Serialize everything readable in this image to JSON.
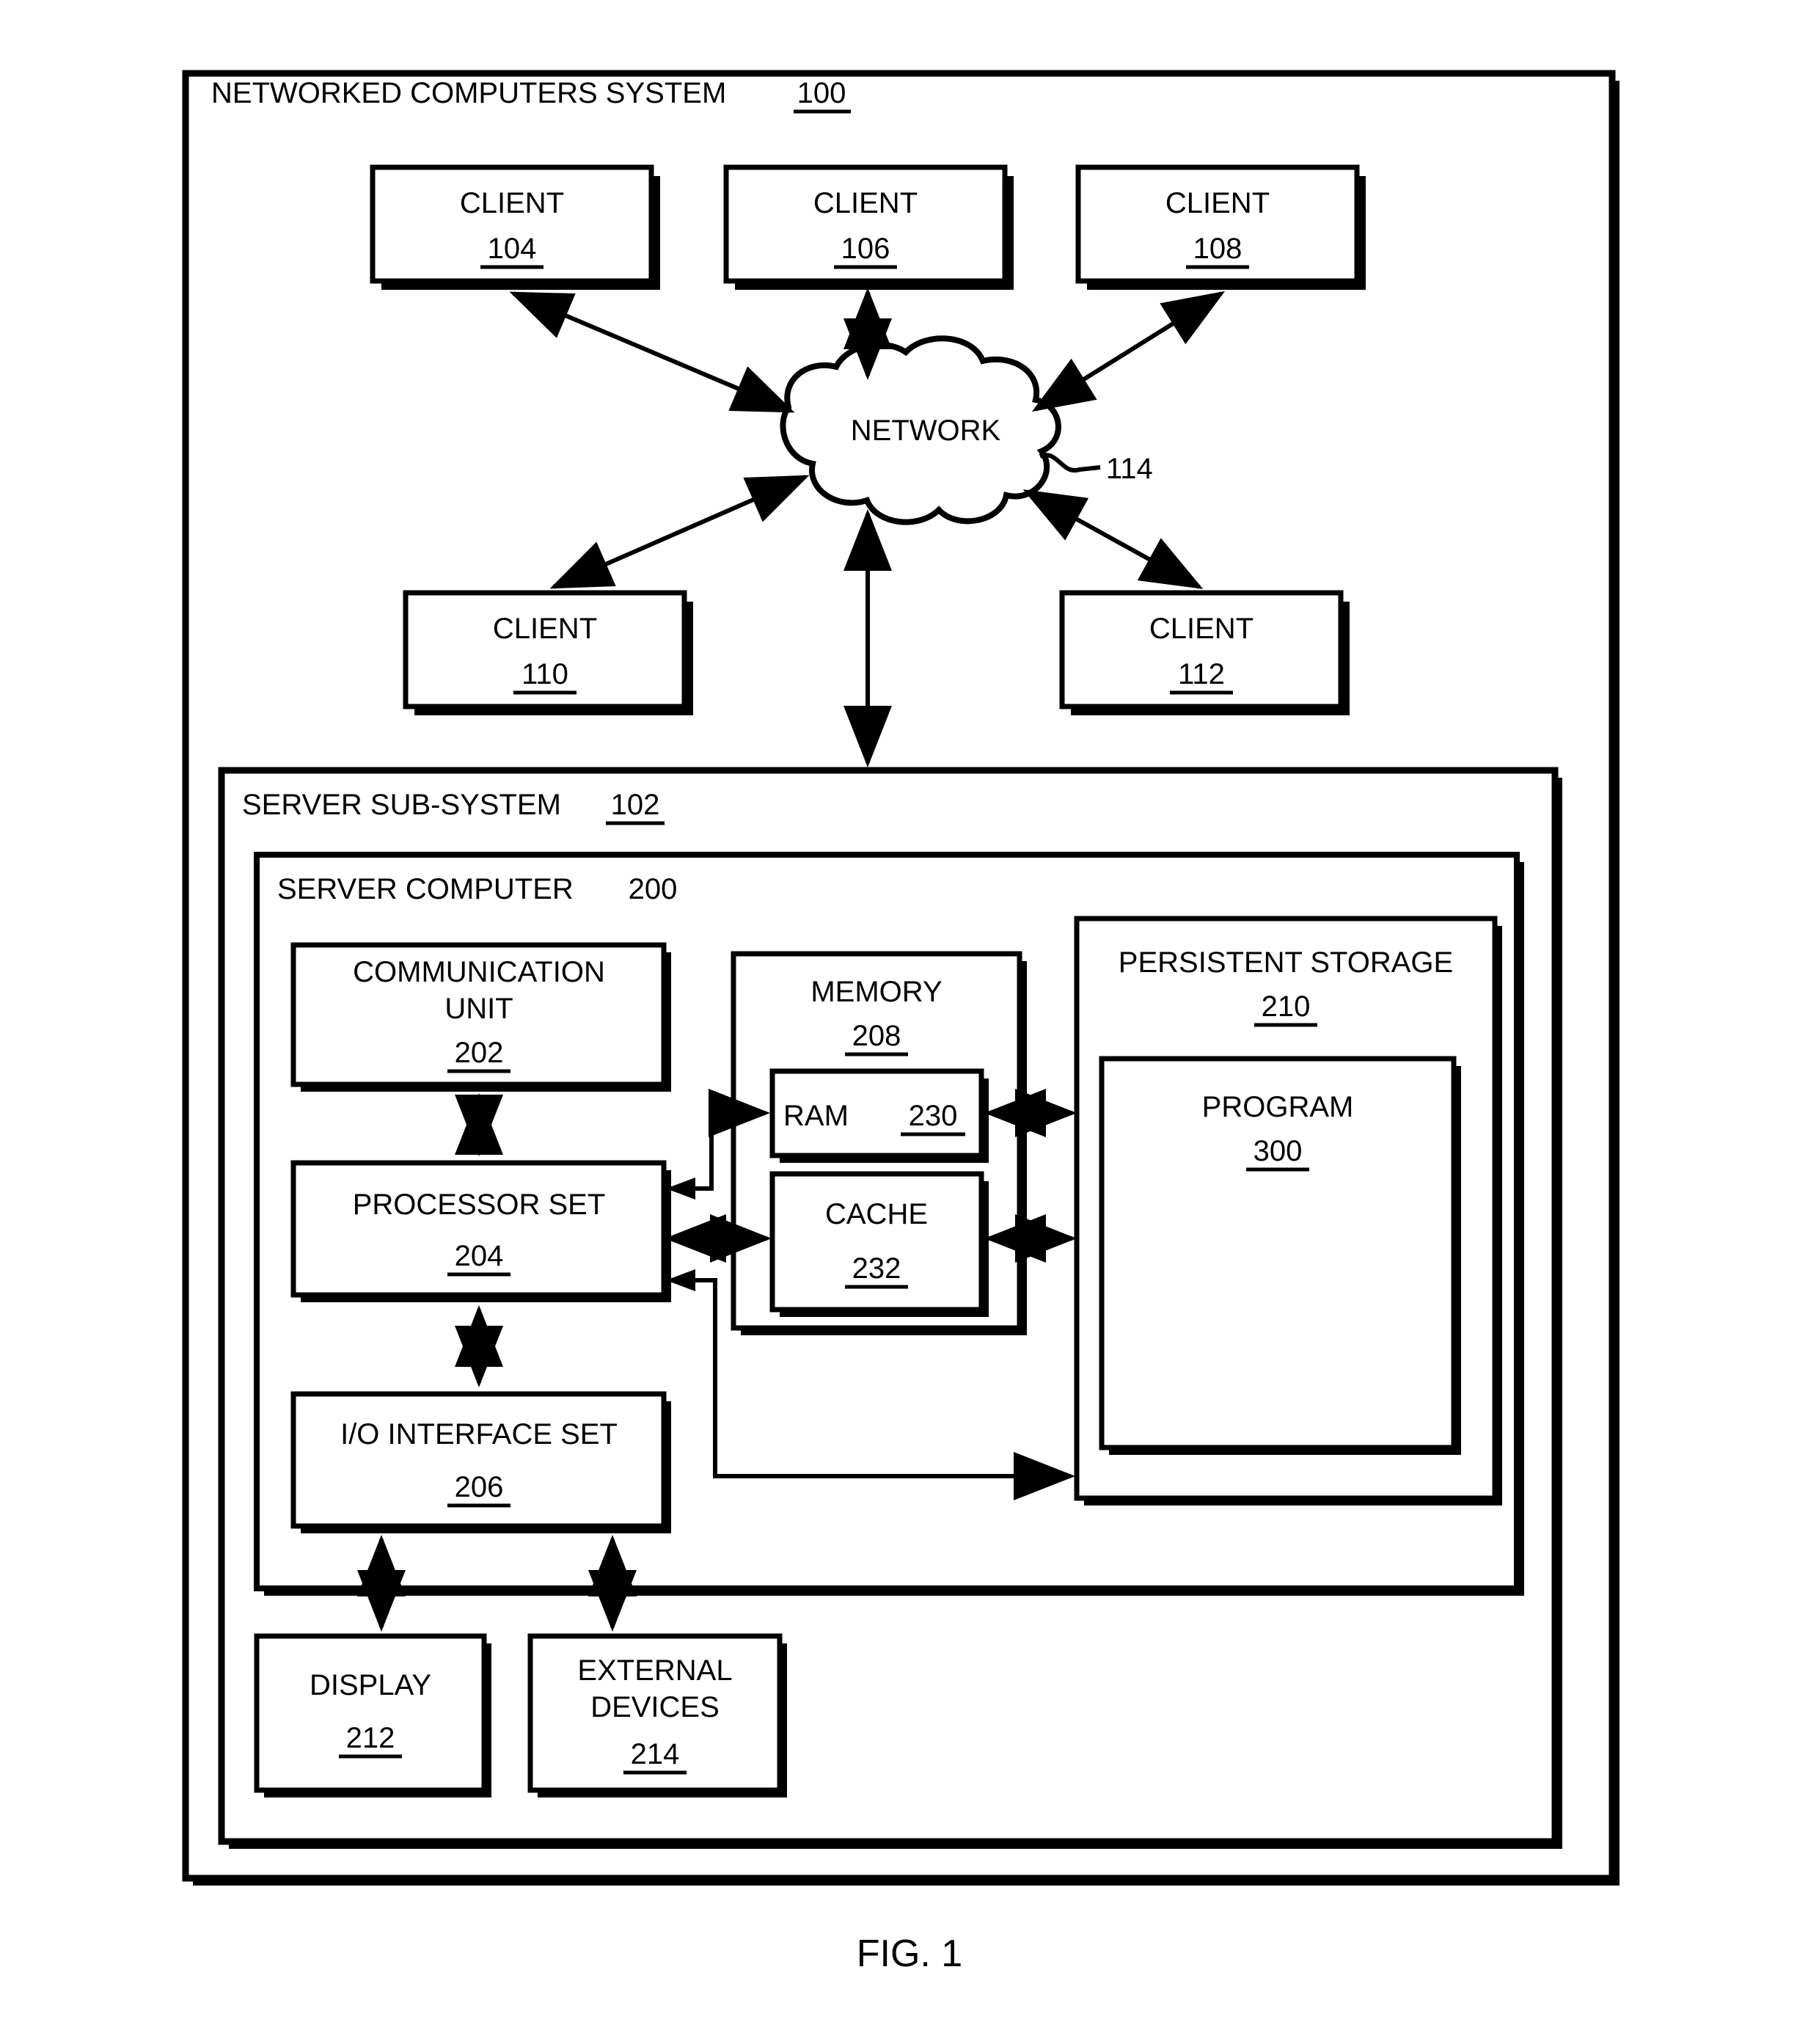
{
  "figure": {
    "caption": "FIG. 1",
    "outer_title": "NETWORKED COMPUTERS SYSTEM",
    "outer_ref": "100"
  },
  "clients": [
    {
      "label": "CLIENT",
      "ref": "104"
    },
    {
      "label": "CLIENT",
      "ref": "106"
    },
    {
      "label": "CLIENT",
      "ref": "108"
    },
    {
      "label": "CLIENT",
      "ref": "110"
    },
    {
      "label": "CLIENT",
      "ref": "112"
    }
  ],
  "network": {
    "label": "NETWORK",
    "ref": "114"
  },
  "server_subsystem": {
    "title": "SERVER SUB-SYSTEM",
    "ref": "102"
  },
  "server_computer": {
    "title": "SERVER COMPUTER",
    "ref": "200"
  },
  "components": {
    "communication_unit": {
      "line1": "COMMUNICATION",
      "line2": "UNIT",
      "ref": "202"
    },
    "processor_set": {
      "line1": "PROCESSOR SET",
      "ref": "204"
    },
    "io_interface_set": {
      "line1": "I/O INTERFACE SET",
      "ref": "206"
    },
    "memory": {
      "line1": "MEMORY",
      "ref": "208"
    },
    "ram": {
      "line1": "RAM",
      "ref": "230"
    },
    "cache": {
      "line1": "CACHE",
      "ref": "232"
    },
    "persistent_storage": {
      "line1": "PERSISTENT STORAGE",
      "ref": "210"
    },
    "program": {
      "line1": "PROGRAM",
      "ref": "300"
    },
    "display": {
      "line1": "DISPLAY",
      "ref": "212"
    },
    "external_devices": {
      "line1": "EXTERNAL",
      "line2": "DEVICES",
      "ref": "214"
    }
  },
  "colors": {
    "stroke": "#000000",
    "fill": "#ffffff"
  }
}
